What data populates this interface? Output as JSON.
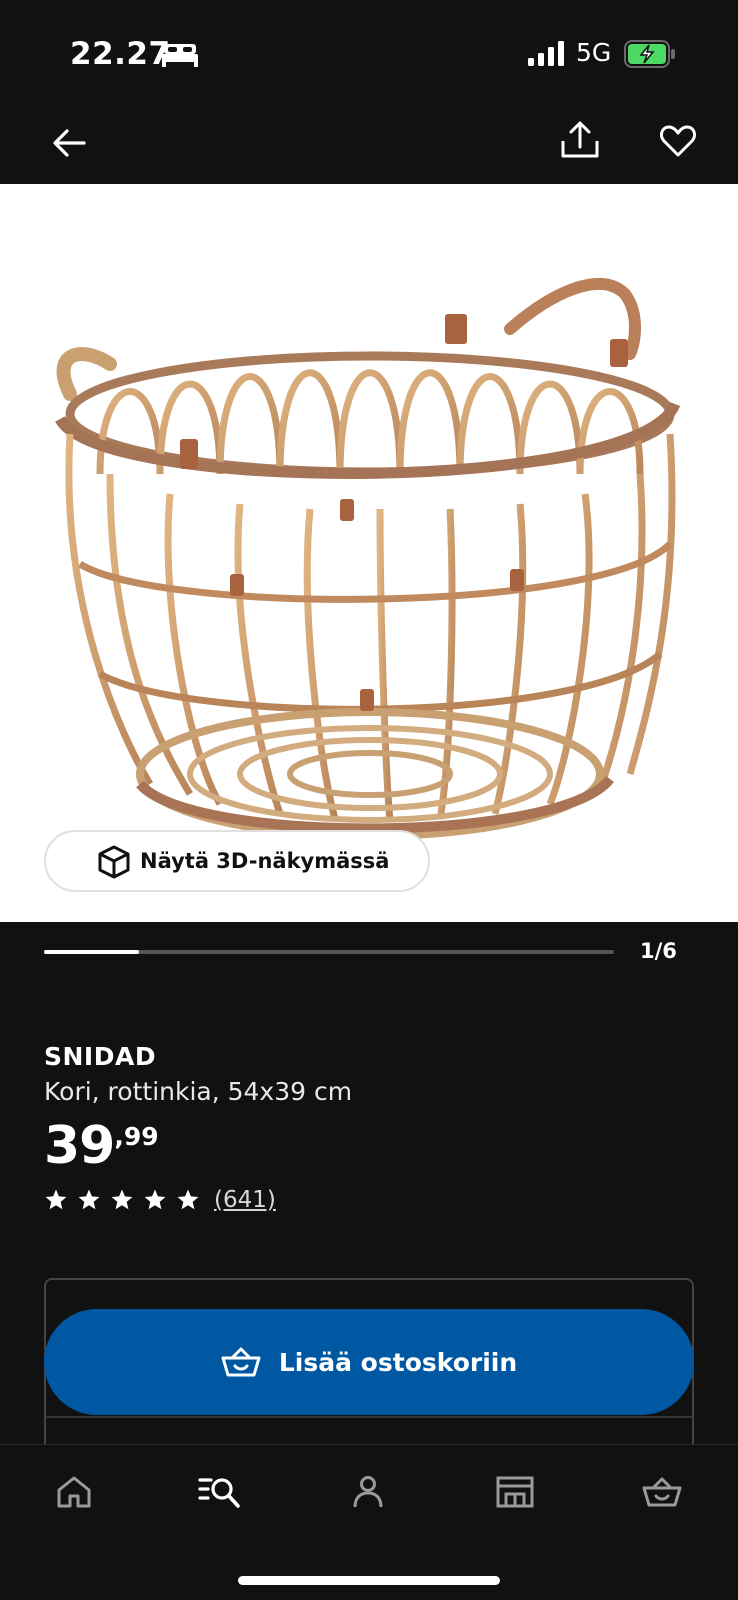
{
  "status_bar": {
    "time": "22.27",
    "network": "5G",
    "icons": [
      "bed-icon",
      "signal-icon",
      "battery-charging-icon"
    ],
    "battery_color": "#4cd964"
  },
  "nav": {
    "icons": [
      "back-arrow-icon",
      "share-icon",
      "heart-icon"
    ]
  },
  "gallery": {
    "view_3d_label": "Näytä 3D-näkymässä",
    "current": 1,
    "total": 6,
    "counter_label": "1/6",
    "image_subject": "rattan basket"
  },
  "product": {
    "name": "SNIDAD",
    "description": "Kori, rottinkia, 54x39 cm",
    "price_whole": "39",
    "price_decimals": ",99",
    "rating_stars": 5,
    "review_count": "(641)"
  },
  "cart": {
    "add_label": "Lisää ostoskoriin",
    "button_color": "#0058a3"
  },
  "tab_bar": {
    "items": [
      "home-icon",
      "search-list-icon",
      "profile-icon",
      "store-icon",
      "cart-icon"
    ]
  }
}
